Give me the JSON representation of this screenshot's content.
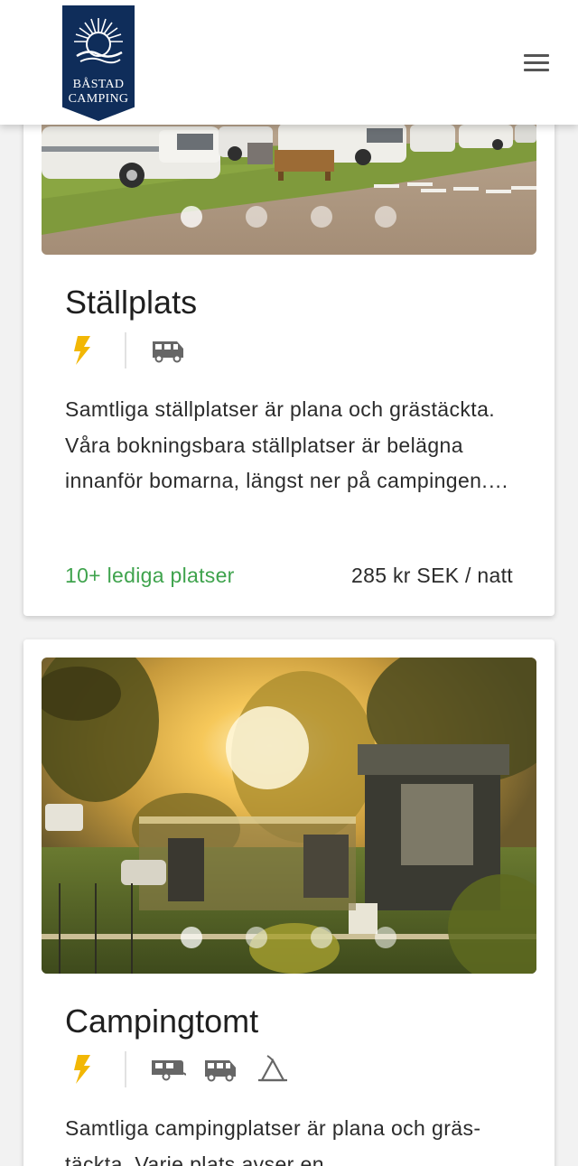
{
  "header": {
    "logo_line1": "BÅSTAD",
    "logo_line2": "CAMPING",
    "menu_icon": "hamburger-menu-icon"
  },
  "colors": {
    "brand_navy": "#0f2d5a",
    "availability_green": "#3fa34d",
    "electricity_yellow": "#f2b705",
    "icon_gray": "#666666"
  },
  "cards": [
    {
      "title": "Ställplats",
      "amenities": [
        "electricity-icon",
        "motorhome-icon"
      ],
      "description": "Samtliga ställplatser är plana och gräs­täckta. Våra bokningsbara ställplatser är belägna innanför bomarna, längst ner på campingen.…",
      "availability": "10+ lediga platser",
      "price": "285 kr SEK / natt",
      "carousel_dots": 4,
      "active_dot": 1
    },
    {
      "title": "Campingtomt",
      "amenities": [
        "electricity-icon",
        "caravan-icon",
        "motorhome-icon",
        "tent-icon"
      ],
      "description": "Samtliga campingplatser är plana och gräs­täckta. Varje plats avser en",
      "carousel_dots": 4,
      "active_dot": 1
    }
  ]
}
